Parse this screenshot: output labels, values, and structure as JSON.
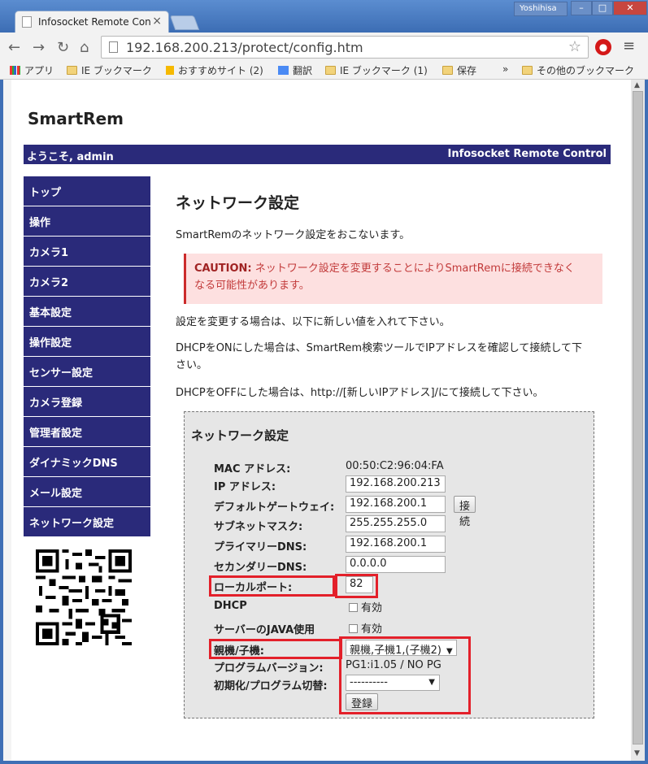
{
  "browser": {
    "tab_title": "Infosocket Remote Con",
    "tab_close": "×",
    "user": "Yoshihisa",
    "url": "192.168.200.213/protect/config.htm",
    "window_buttons": [
      "–",
      "□",
      "✕"
    ],
    "bookmarks": [
      "アプリ",
      "IE ブックマーク",
      "おすすめサイト (2)",
      "翻訳",
      "IE ブックマーク (1)",
      "保存",
      "»",
      "その他のブックマーク"
    ]
  },
  "page": {
    "brand": "SmartRem",
    "welcome": "ようこそ, admin",
    "product": "Infosocket Remote Control",
    "nav": [
      "トップ",
      "操作",
      "カメラ1",
      "カメラ2",
      "基本設定",
      "操作設定",
      "センサー設定",
      "カメラ登録",
      "管理者設定",
      "ダイナミックDNS",
      "メール設定",
      "ネットワーク設定"
    ],
    "heading": "ネットワーク設定",
    "intro": "SmartRemのネットワーク設定をおこないます。",
    "caution_label": "CAUTION:",
    "caution_text_1": " ネットワーク設定を変更することによりSmartRemに接続できなく",
    "caution_text_2": "なる可能性があります。",
    "p1": "設定を変更する場合は、以下に新しい値を入れて下さい。",
    "p2_1": "DHCPをONにした場合は、SmartRem検索ツールでIPアドレスを確認して接続して下",
    "p2_2": "さい。",
    "p3": "DHCPをOFFにした場合は、http://[新しいIPアドレス]/にて接続して下さい。"
  },
  "form": {
    "title": "ネットワーク設定",
    "mac_label": "MAC アドレス:",
    "mac_value": "00:50:C2:96:04:FA",
    "ip_label": "IP アドレス:",
    "ip_value": "192.168.200.213",
    "gw_label": "デフォルトゲートウェイ:",
    "gw_value": "192.168.200.1",
    "connect_button": "接続",
    "mask_label": "サブネットマスク:",
    "mask_value": "255.255.255.0",
    "dns1_label": "プライマリーDNS:",
    "dns1_value": "192.168.200.1",
    "dns2_label": "セカンダリーDNS:",
    "dns2_value": "0.0.0.0",
    "port_label": "ローカルポート:",
    "port_value": "82",
    "dhcp_label": "DHCP",
    "dhcp_check": "有効",
    "java_label": "サーバーのJAVA使用",
    "java_check": "有効",
    "role_label": "親機/子機:",
    "role_value": "親機,子機1,(子機2)",
    "version_label": "プログラムバージョン:",
    "version_value": "PG1:i1.05 / NO PG",
    "init_label": "初期化/プログラム切替:",
    "init_value": "----------",
    "register_button": "登録"
  },
  "colors": {
    "nav_bg": "#2a2a7a",
    "caution_bg": "#fde0e0",
    "highlight": "#e3202a"
  }
}
